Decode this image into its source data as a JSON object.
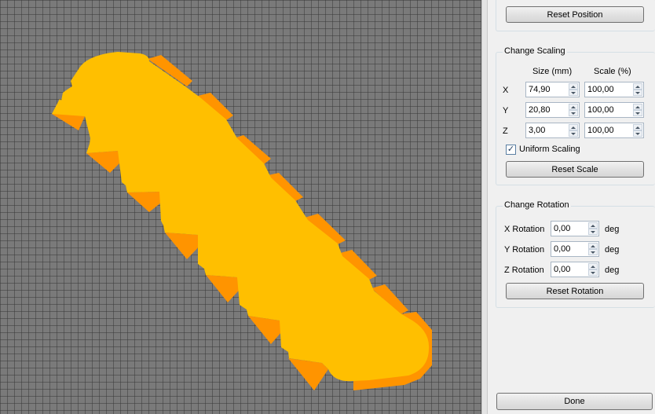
{
  "position": {
    "reset_label": "Reset Position"
  },
  "scaling": {
    "title": "Change Scaling",
    "size_header": "Size (mm)",
    "scale_header": "Scale (%)",
    "rows": [
      {
        "axis": "X",
        "size": "74,90",
        "scale": "100,00"
      },
      {
        "axis": "Y",
        "size": "20,80",
        "scale": "100,00"
      },
      {
        "axis": "Z",
        "size": "3,00",
        "scale": "100,00"
      }
    ],
    "uniform_label": "Uniform Scaling",
    "uniform_checked": true,
    "uniform_mark": "✓",
    "reset_label": "Reset Scale"
  },
  "rotation": {
    "title": "Change Rotation",
    "rows": [
      {
        "label": "X Rotation",
        "value": "0,00",
        "unit": "deg"
      },
      {
        "label": "Y Rotation",
        "value": "0,00",
        "unit": "deg"
      },
      {
        "label": "Z Rotation",
        "value": "0,00",
        "unit": "deg"
      }
    ],
    "reset_label": "Reset Rotation"
  },
  "done_label": "Done",
  "colors": {
    "model_top": "#ffbf00",
    "model_side": "#ff9400",
    "grid_bg": "#7a7a7a",
    "panel_bg": "#f0f0f0"
  }
}
